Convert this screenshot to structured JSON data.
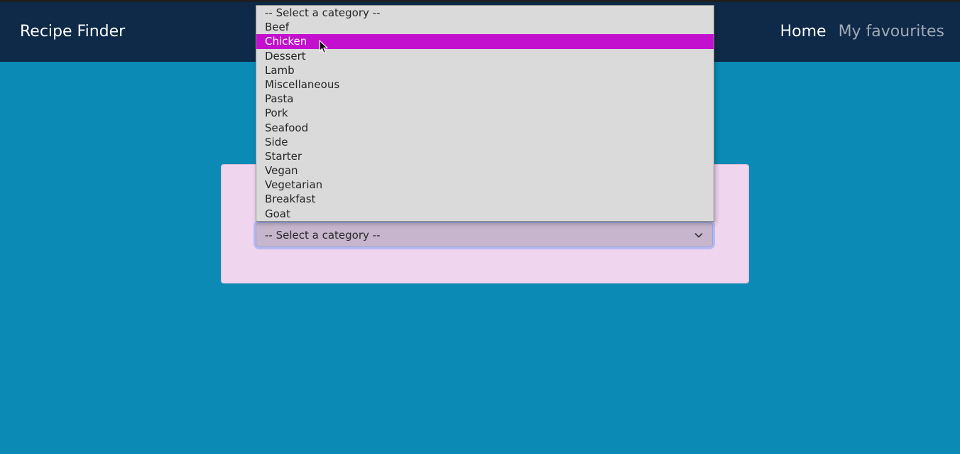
{
  "navbar": {
    "brand": "Recipe Finder",
    "links": [
      {
        "label": "Home",
        "active": true
      },
      {
        "label": "My favourites",
        "active": false
      }
    ]
  },
  "category_select": {
    "selected_value": "-- Select a category --",
    "highlighted_option": "Chicken",
    "options": [
      "-- Select a category --",
      "Beef",
      "Chicken",
      "Dessert",
      "Lamb",
      "Miscellaneous",
      "Pasta",
      "Pork",
      "Seafood",
      "Side",
      "Starter",
      "Vegan",
      "Vegetarian",
      "Breakfast",
      "Goat"
    ]
  },
  "colors": {
    "page_bg": "#0a8ab5",
    "navbar_bg": "#0f2a48",
    "card_bg": "#efd5ee",
    "highlight": "#c310cf"
  },
  "icons": {
    "select_arrow": "chevron-down-icon",
    "pointer": "mouse-cursor-icon"
  }
}
